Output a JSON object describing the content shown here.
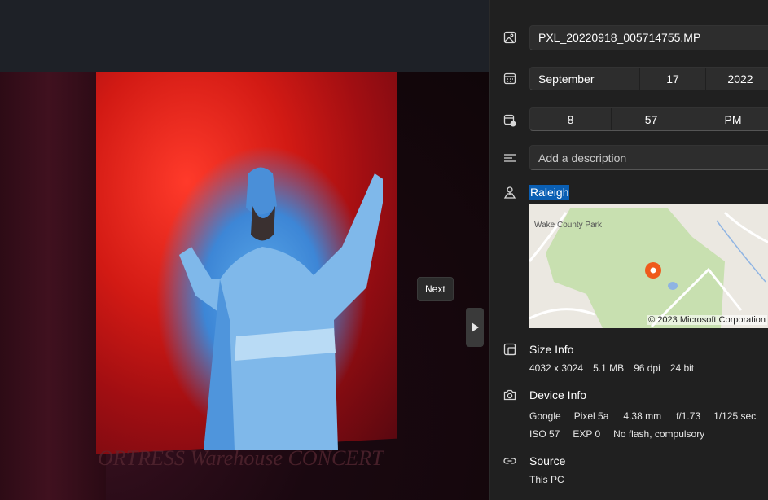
{
  "viewer": {
    "tooltip": "Next"
  },
  "info": {
    "filename": "PXL_20220918_005714755.MP",
    "date": {
      "month": "September",
      "day": "17",
      "year": "2022"
    },
    "time": {
      "hour": "8",
      "minute": "57",
      "ampm": "PM"
    },
    "description_placeholder": "Add a description",
    "location": "Raleigh",
    "map": {
      "park_label": "Wake County Park",
      "copyright": "© 2023 Microsoft Corporation"
    },
    "size": {
      "title": "Size Info",
      "values": [
        "4032 x 3024",
        "5.1 MB",
        "96 dpi",
        "24 bit"
      ]
    },
    "device": {
      "title": "Device Info",
      "line1": [
        "Google",
        "Pixel 5a",
        "4.38 mm",
        "f/1.73",
        "1/125 sec"
      ],
      "line2": [
        "ISO 57",
        "EXP 0",
        "No flash, compulsory"
      ]
    },
    "source": {
      "title": "Source",
      "value": "This PC"
    }
  },
  "photo_sign": "ORTRESS Warehouse CONCERT"
}
